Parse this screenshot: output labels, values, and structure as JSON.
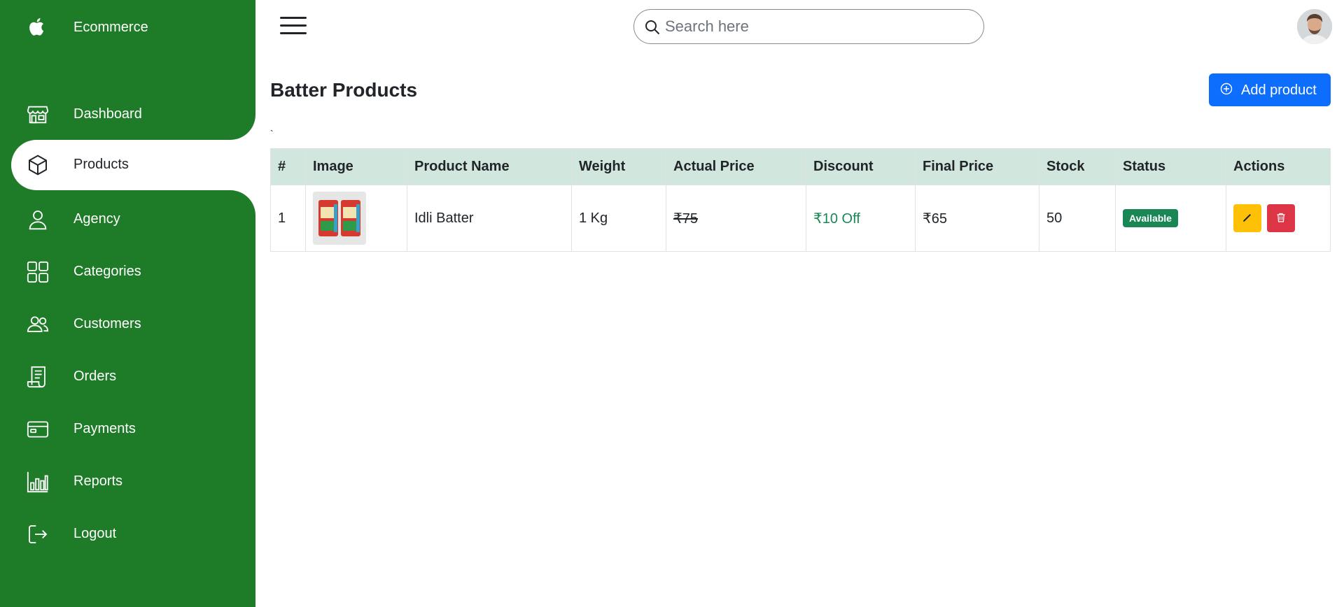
{
  "brand": {
    "name": "Ecommerce",
    "icon": "apple-icon"
  },
  "sidebar": {
    "items": [
      {
        "label": "Dashboard",
        "icon": "store-icon",
        "active": false
      },
      {
        "label": "Products",
        "icon": "box-icon",
        "active": true
      },
      {
        "label": "Agency",
        "icon": "person-icon",
        "active": false
      },
      {
        "label": "Categories",
        "icon": "grid-icon",
        "active": false
      },
      {
        "label": "Customers",
        "icon": "people-icon",
        "active": false
      },
      {
        "label": "Orders",
        "icon": "receipt-icon",
        "active": false
      },
      {
        "label": "Payments",
        "icon": "credit-card-icon",
        "active": false
      },
      {
        "label": "Reports",
        "icon": "bar-chart-icon",
        "active": false
      },
      {
        "label": "Logout",
        "icon": "logout-icon",
        "active": false
      }
    ]
  },
  "search": {
    "placeholder": "Search here",
    "value": ""
  },
  "page": {
    "title": "Batter Products",
    "add_label": "Add product",
    "stray_char": "`"
  },
  "table": {
    "headers": [
      "#",
      "Image",
      "Product Name",
      "Weight",
      "Actual Price",
      "Discount",
      "Final Price",
      "Stock",
      "Status",
      "Actions"
    ],
    "rows": [
      {
        "index": "1",
        "image_alt": "Idli Batter",
        "name": "Idli Batter",
        "weight": "1 Kg",
        "actual_price": "₹75",
        "discount": "₹10 Off",
        "final_price": "₹65",
        "stock": "50",
        "status": "Available"
      }
    ]
  },
  "colors": {
    "sidebar": "#1e7b28",
    "primary": "#0d6efd",
    "table_header": "#d1e7dd",
    "success": "#198754",
    "warning": "#ffc107",
    "danger": "#dc3545"
  }
}
